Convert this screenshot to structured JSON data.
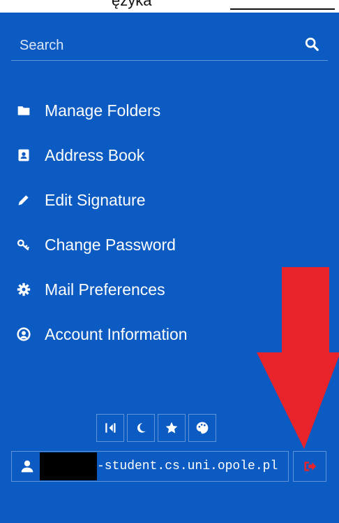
{
  "top_clip": {
    "text": "ęzyka"
  },
  "search": {
    "placeholder": "Search",
    "icon": "search-icon"
  },
  "menu": {
    "items": [
      {
        "label": "Manage Folders",
        "icon": "folder-icon"
      },
      {
        "label": "Address Book",
        "icon": "address-book-icon"
      },
      {
        "label": "Edit Signature",
        "icon": "pencil-icon"
      },
      {
        "label": "Change Password",
        "icon": "key-icon"
      },
      {
        "label": "Mail Preferences",
        "icon": "gear-icon"
      },
      {
        "label": "Account Information",
        "icon": "user-circle-icon"
      }
    ]
  },
  "toolbar": {
    "buttons": [
      {
        "icon": "collapse-sidebar-icon"
      },
      {
        "icon": "moon-icon"
      },
      {
        "icon": "star-icon"
      },
      {
        "icon": "palette-icon"
      }
    ]
  },
  "account": {
    "email_suffix": "-student.cs.uni.opole.pl",
    "user_icon": "user-icon",
    "logout_icon": "logout-icon"
  },
  "colors": {
    "sidebar_bg": "#0b5bc2",
    "text": "#ffffff",
    "logout_icon": "#e8232a",
    "annotation_arrow": "#e8232a"
  }
}
